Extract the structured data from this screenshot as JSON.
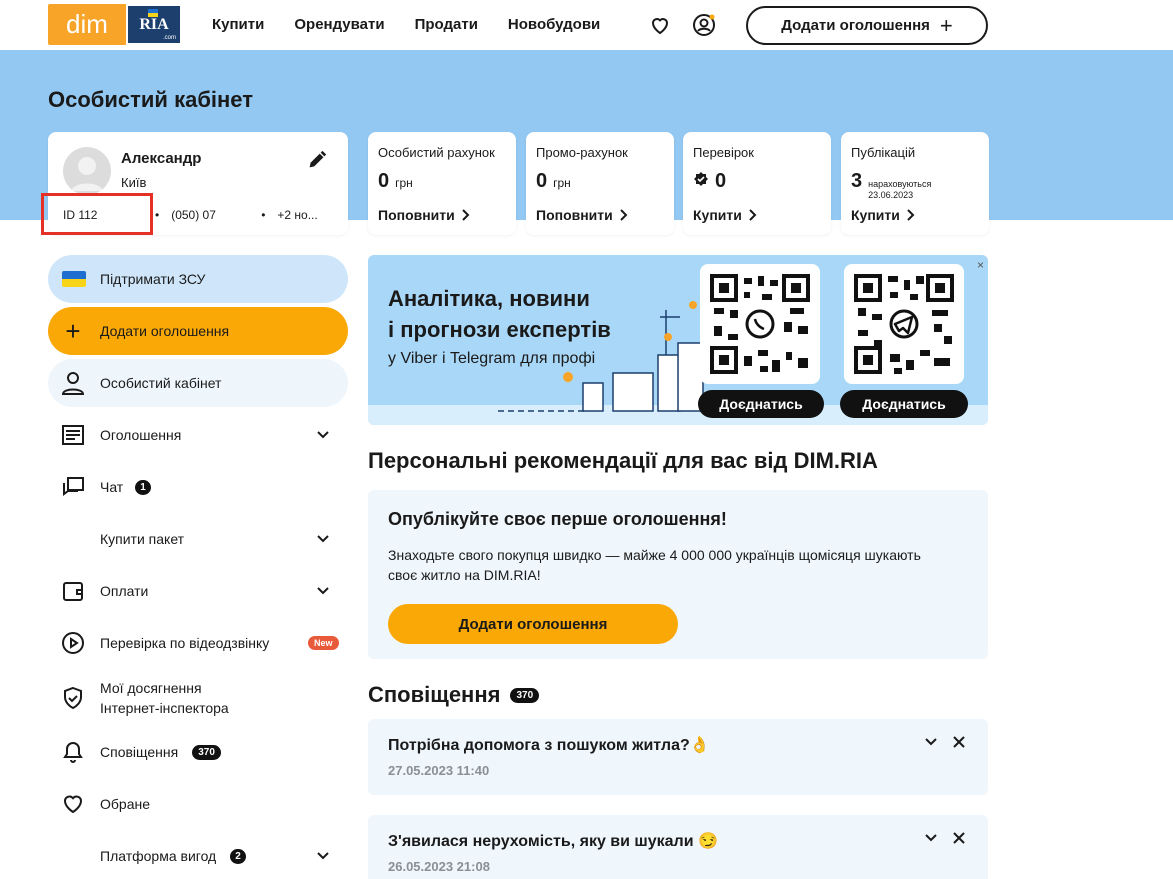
{
  "header": {
    "logo_left": "dim",
    "logo_right": "RIA",
    "logo_suffix": ".com",
    "nav": [
      "Купити",
      "Орендувати",
      "Продати",
      "Новобудови"
    ],
    "add_button": "Додати оголошення"
  },
  "page": {
    "title": "Особистий кабінет"
  },
  "profile": {
    "name": "Александр",
    "city": "Київ",
    "id": "ID 112",
    "phone": "(050) 07",
    "extra": "+2 но..."
  },
  "stats": [
    {
      "label": "Особистий рахунок",
      "value": "0",
      "unit": "грн",
      "action": "Поповнити"
    },
    {
      "label": "Промо-рахунок",
      "value": "0",
      "unit": "грн",
      "action": "Поповнити"
    },
    {
      "label": "Перевірок",
      "value": "0",
      "action": "Купити"
    },
    {
      "label": "Публікацій",
      "value": "3",
      "note1": "нараховуються",
      "note2": "23.06.2023",
      "action": "Купити"
    }
  ],
  "sidebar": {
    "support": "Підтримати ЗСУ",
    "add": "Додати оголошення",
    "cabinet": "Особистий кабінет",
    "items": [
      {
        "label": "Оголошення"
      },
      {
        "label": "Чат",
        "badge": "1"
      },
      {
        "label": "Купити пакет"
      },
      {
        "label": "Оплати"
      },
      {
        "label": "Перевірка по відеодзвінку",
        "badge": "New"
      },
      {
        "label": "Мої досягнення",
        "label2": "Інтернет-інспектора"
      },
      {
        "label": "Сповіщення",
        "badge": "370"
      },
      {
        "label": "Обране"
      },
      {
        "label": "Платформа вигод",
        "badge": "2"
      }
    ]
  },
  "banner": {
    "line1": "Аналітика, новини",
    "line2": "і прогнози експертів",
    "sub": "у Viber і Telegram для профі",
    "join1": "Доєднатись",
    "join2": "Доєднатись",
    "close": "×"
  },
  "recommend": {
    "section_title": "Персональні рекомендації для вас від DIM.RIA",
    "title": "Опублікуйте своє перше оголошення!",
    "text": "Знаходьте свого покупця швидко — майже 4 000 000 українців щомісяця шукають своє житло на DIM.RIA!",
    "button": "Додати оголошення"
  },
  "notifications": {
    "title": "Сповіщення",
    "count": "370",
    "items": [
      {
        "title": "Потрібна допомога з пошуком житла?👌",
        "date": "27.05.2023 11:40"
      },
      {
        "title": "З'явилася нерухомість, яку ви шукали 😏",
        "date": "26.05.2023 21:08"
      }
    ]
  },
  "colors": {
    "band": "#93c8f2",
    "accent": "#f9a806",
    "support_pill": "#cfe6fa",
    "cabinet_pill": "#eef6fc",
    "highlight": "#e53025"
  }
}
